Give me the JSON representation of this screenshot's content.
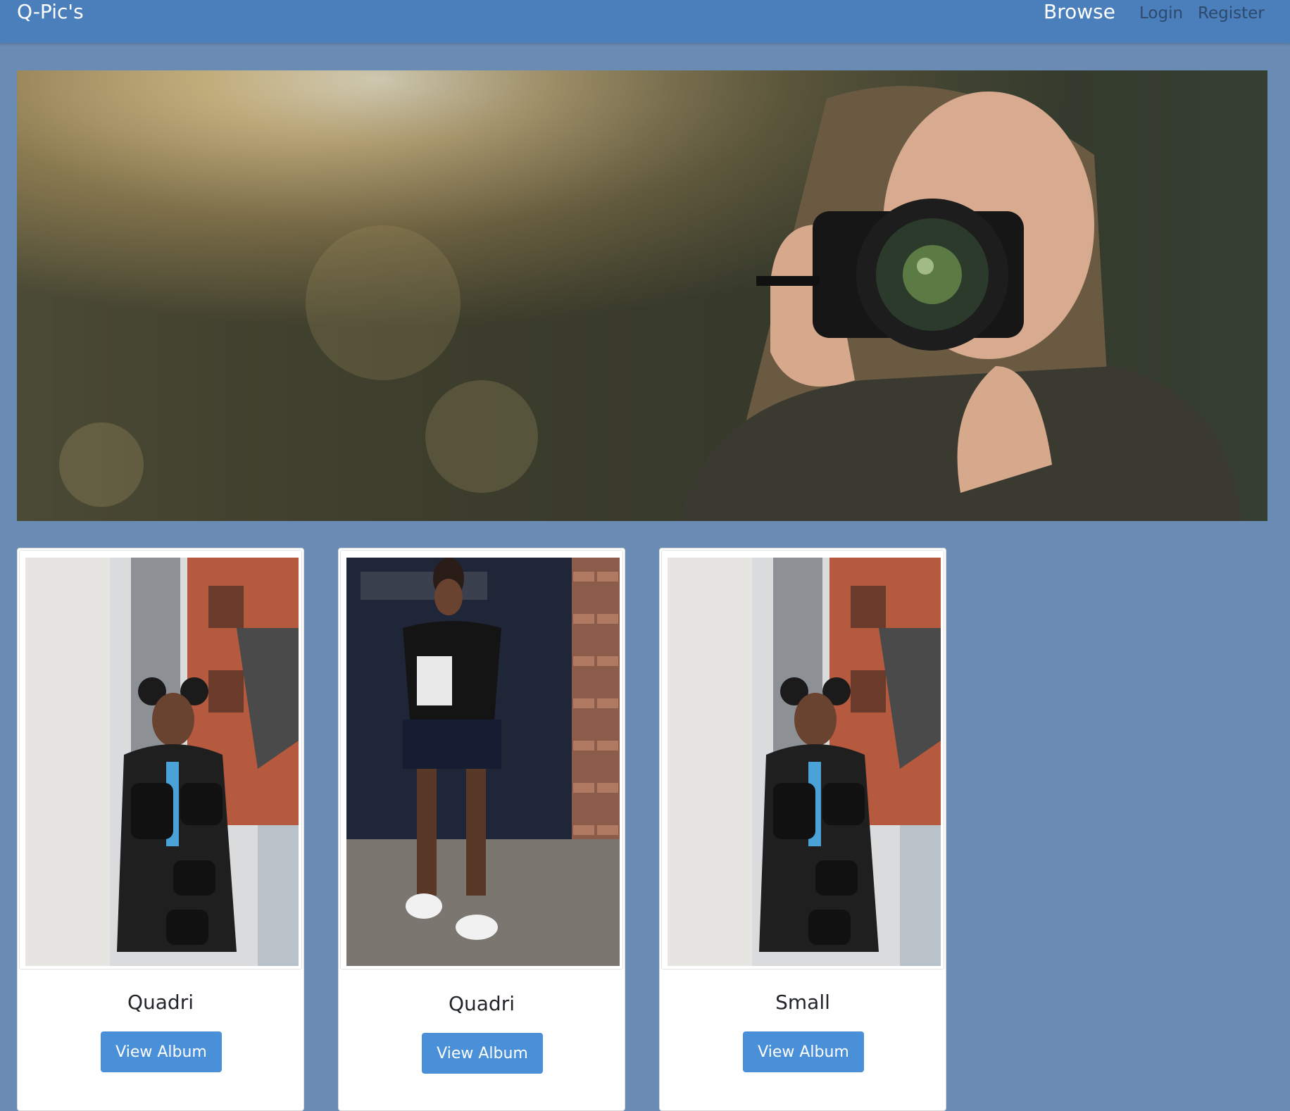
{
  "navbar": {
    "brand": "Q-Pic's",
    "links": [
      {
        "label": "Browse"
      },
      {
        "label": "Login"
      },
      {
        "label": "Register"
      }
    ]
  },
  "hero": {
    "image_icon": "photographer-camera-banner-image"
  },
  "albums": [
    {
      "title": "Quadri",
      "button_label": "View Album",
      "image_icon": "woman-with-bags-photo"
    },
    {
      "title": "Quadri",
      "button_label": "View Album",
      "image_icon": "woman-parking-door-photo"
    },
    {
      "title": "Small",
      "button_label": "View Album",
      "image_icon": "woman-with-bags-photo"
    }
  ],
  "colors": {
    "navbar": "#4a7fbb",
    "page_background": "#6a8bb3",
    "button": "#4a90d9"
  }
}
